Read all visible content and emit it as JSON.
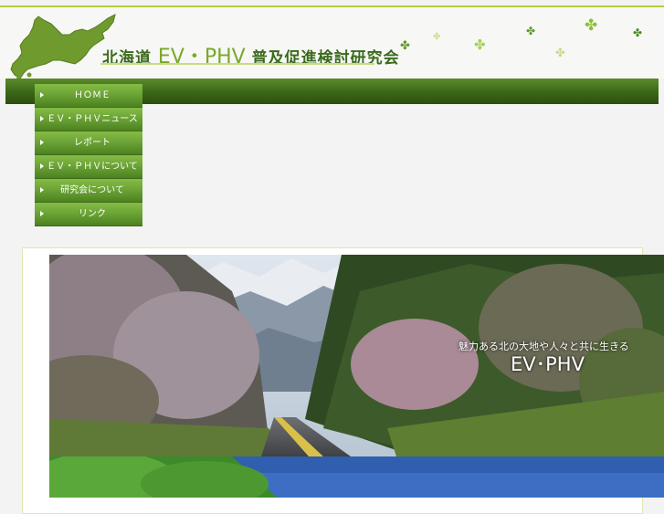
{
  "header": {
    "title_prefix": "北海道",
    "title_ev": "EV・PHV",
    "title_suffix": "普及促進検討研究会",
    "logo_icon": "hokkaido-map-icon",
    "decoration_icon": "clover-icon",
    "clover_glyph": "✤"
  },
  "menu": {
    "items": [
      {
        "label": "ＨＯＭＥ"
      },
      {
        "label": "ＥＶ・ＰＨＶニュース"
      },
      {
        "label": "レポート"
      },
      {
        "label": "ＥＶ・ＰＨＶについて"
      },
      {
        "label": "研究会について"
      },
      {
        "label": "リンク"
      }
    ]
  },
  "hero": {
    "caption": "魅力ある北の大地や人々と共に生きる",
    "caption_main": "EV･PHV"
  },
  "colors": {
    "accent": "#b5cf3f",
    "nav_dark": "#3d6a18",
    "menu_green": "#6ca437",
    "title_green": "#3b6a1c"
  }
}
